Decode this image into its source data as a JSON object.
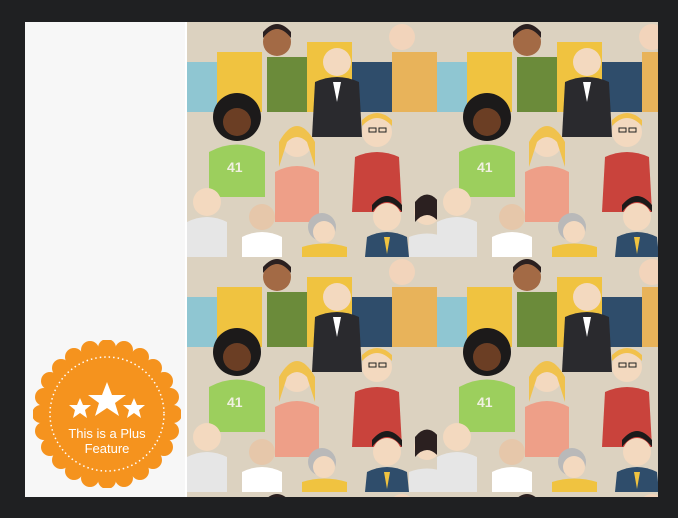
{
  "badge": {
    "line1": "This is a Plus",
    "line2": "Feature",
    "color": "#f5931e",
    "icon": "stars-icon"
  },
  "preview": {
    "pattern_number": "41"
  }
}
